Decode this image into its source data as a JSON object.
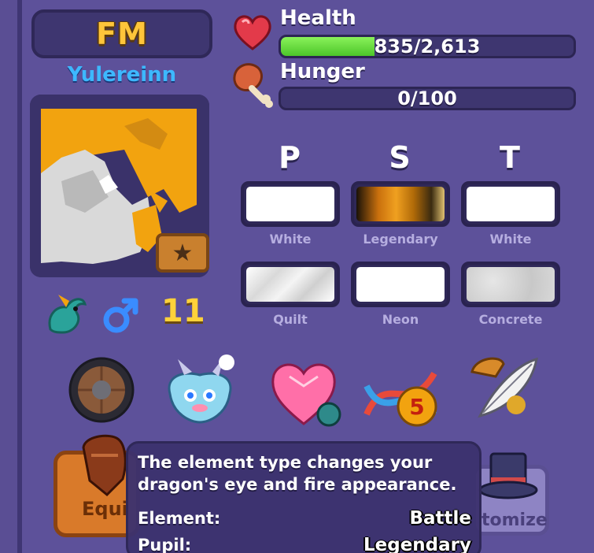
{
  "dragon": {
    "code": "FM",
    "owner": "Yulereinn",
    "count": "11"
  },
  "stats": {
    "health": {
      "label": "Health",
      "text": "835/2,613",
      "fraction": 0.3196
    },
    "hunger": {
      "label": "Hunger",
      "text": "0/100",
      "fraction": 0.0
    }
  },
  "traits": {
    "columns": [
      "P",
      "S",
      "T"
    ],
    "row1": [
      {
        "label": "White",
        "color": "#ffffff"
      },
      {
        "label": "Legendary",
        "color": "#e8a32a"
      },
      {
        "label": "White",
        "color": "#ffffff"
      }
    ],
    "row2": [
      {
        "label": "Quilt",
        "color": "#e8e8e8"
      },
      {
        "label": "Neon",
        "color": "#ffffff"
      },
      {
        "label": "Concrete",
        "color": "#dcdcdc"
      }
    ]
  },
  "items": [
    "shield-icon",
    "pet-dragon-icon",
    "heart-gem-icon",
    "dna-5-icon",
    "feather-hat-icon"
  ],
  "item_badge": "5",
  "buttons": {
    "equip_label": "Equi",
    "customize_label": "tomize"
  },
  "tooltip": {
    "description": "The element type changes your dragon's eye and fire appearance.",
    "rows": [
      {
        "key": "Element:",
        "value": "Battle"
      },
      {
        "key": "Pupil:",
        "value": "Legendary"
      }
    ]
  }
}
